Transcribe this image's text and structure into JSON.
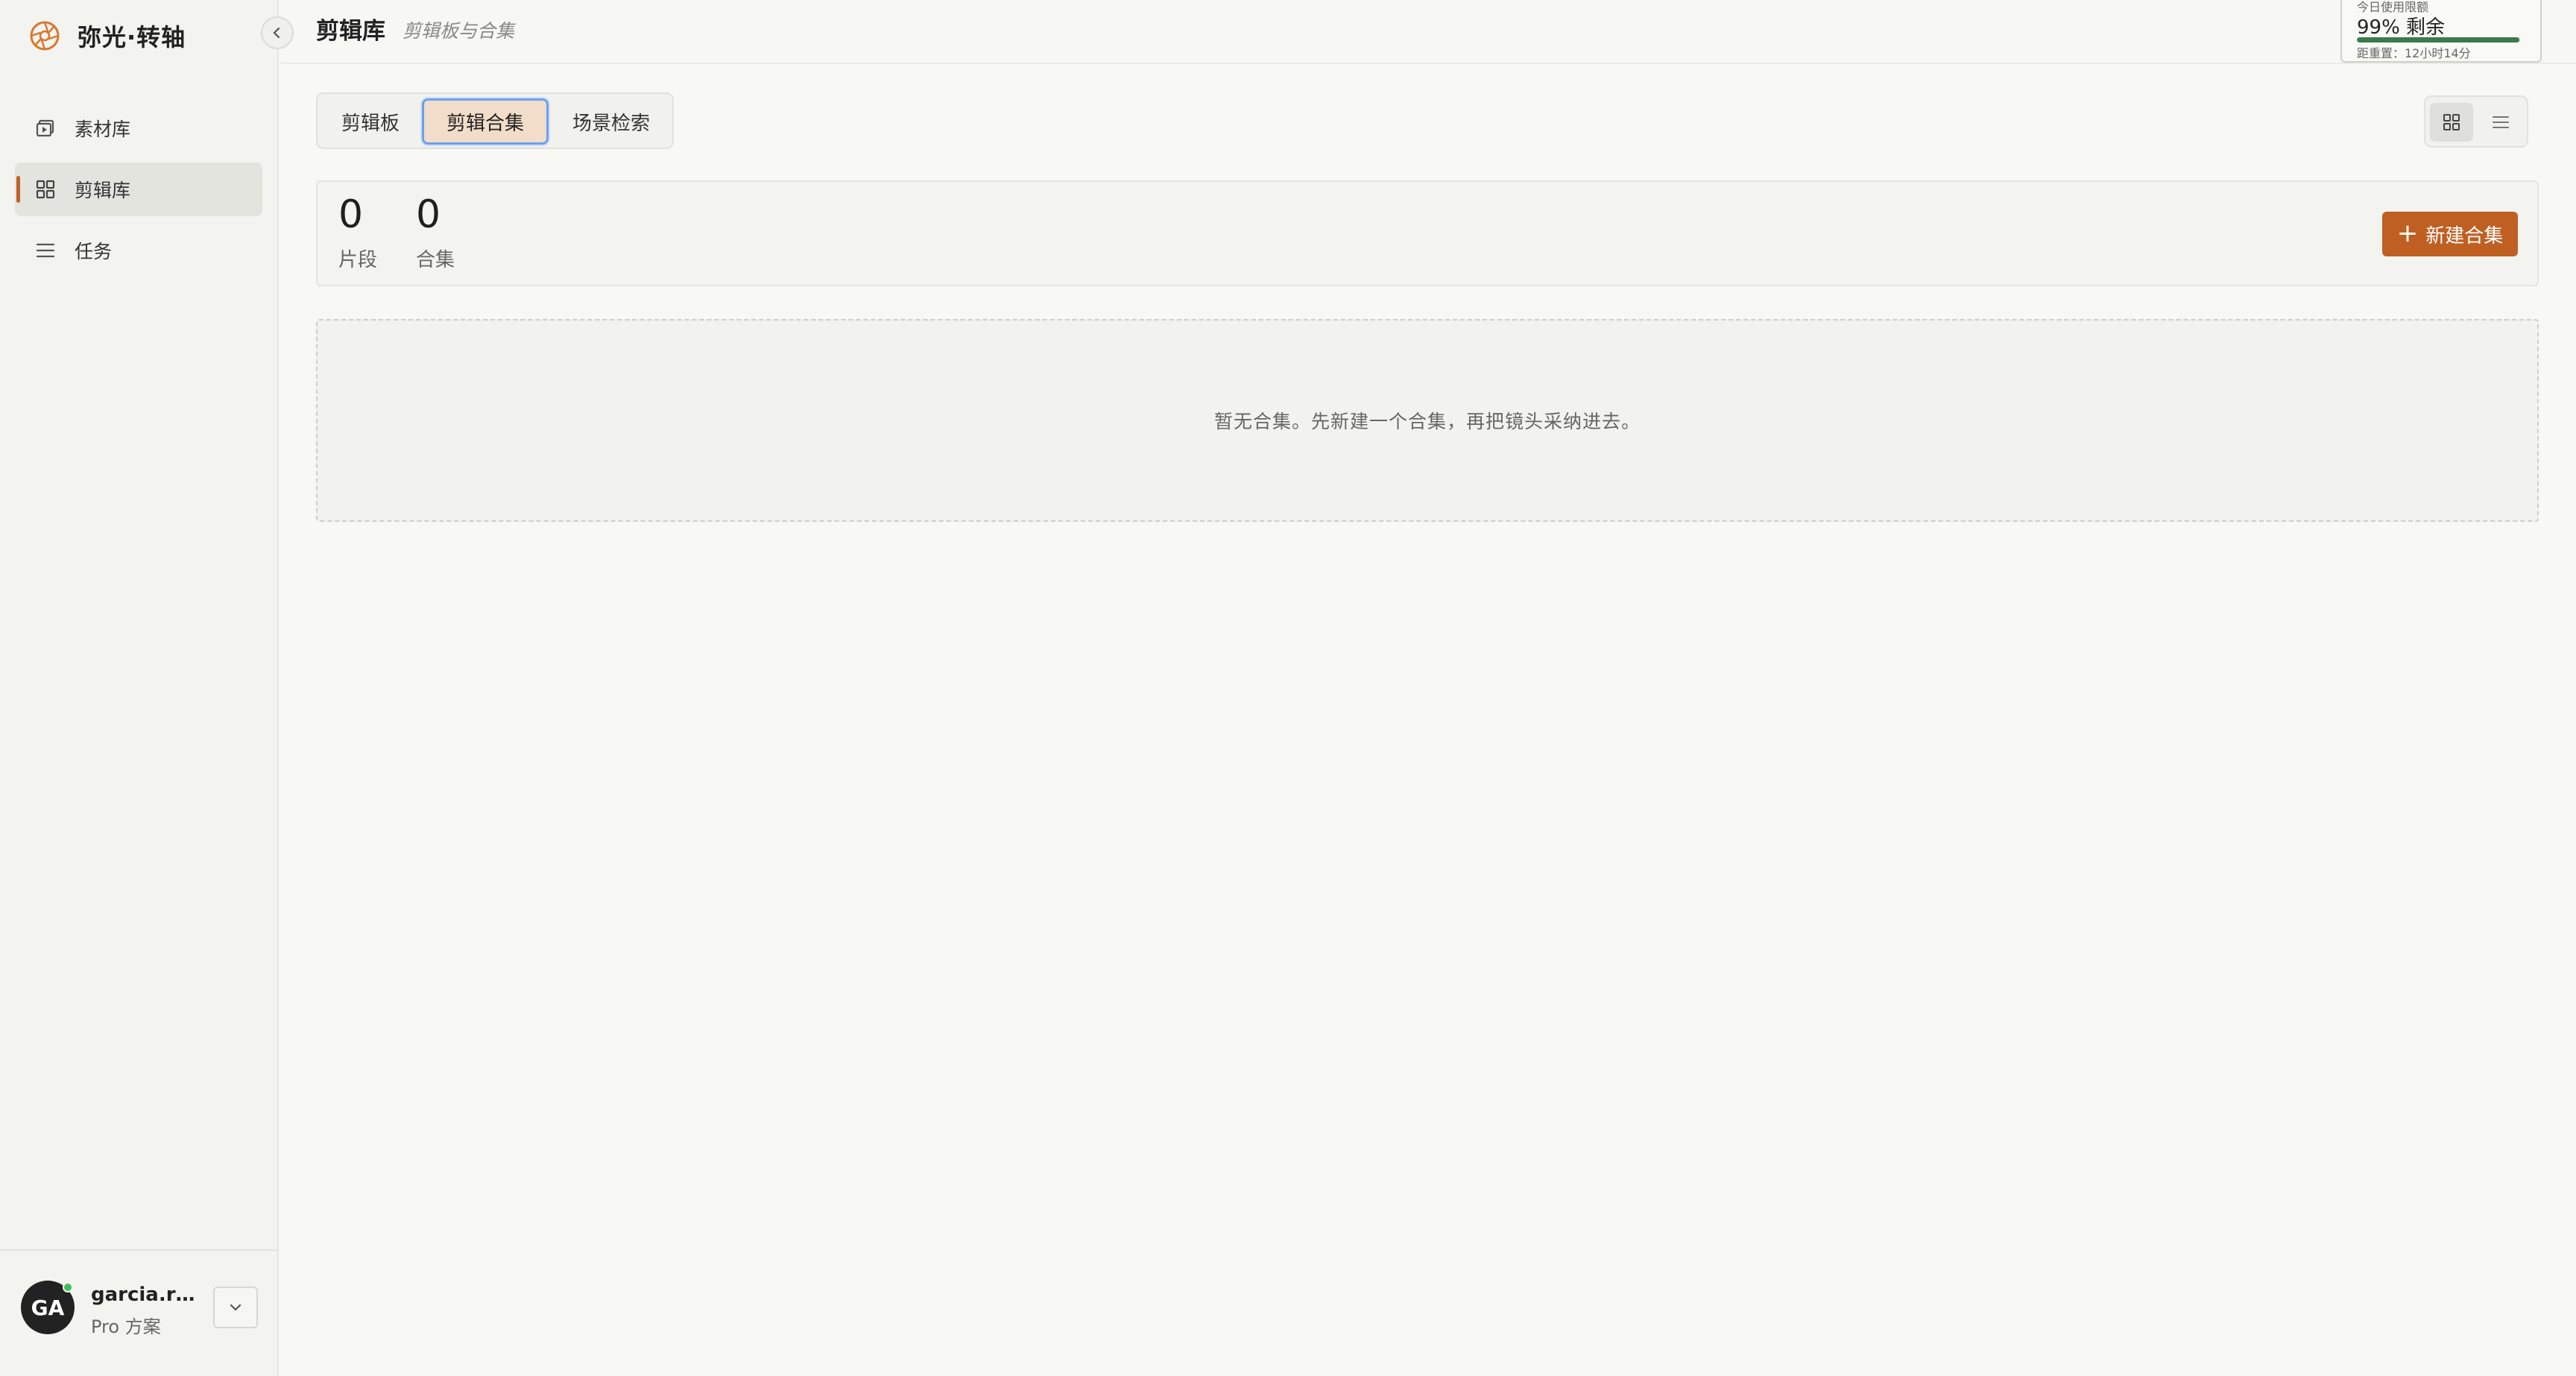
{
  "brand": {
    "name": "弥光·转轴",
    "logo_icon": "aperture-logo",
    "accent_color": "#bf5f22"
  },
  "sidebar": {
    "items": [
      {
        "label": "素材库",
        "icon": "media-library-icon",
        "active": false
      },
      {
        "label": "剪辑库",
        "icon": "grid-icon",
        "active": true
      },
      {
        "label": "任务",
        "icon": "list-icon",
        "active": false
      }
    ]
  },
  "user": {
    "initials": "GA",
    "name": "garcia.rel...",
    "plan": "Pro 方案",
    "online": true
  },
  "header": {
    "title": "剪辑库",
    "subtitle": "剪辑板与合集"
  },
  "quota": {
    "label": "今日使用限额",
    "value": "99% 剩余",
    "fraction_remaining": 0.99,
    "reset": "距重置：12小时14分"
  },
  "tabs": [
    {
      "label": "剪辑板",
      "selected": false
    },
    {
      "label": "剪辑合集",
      "selected": true
    },
    {
      "label": "场景检索",
      "selected": false
    }
  ],
  "view_mode": {
    "selected": "grid"
  },
  "stats": [
    {
      "value": "0",
      "label": "片段"
    },
    {
      "value": "0",
      "label": "合集"
    }
  ],
  "actions": {
    "new_collection": "新建合集"
  },
  "empty_state": {
    "message": "暂无合集。先新建一个合集，再把镜头采纳进去。"
  }
}
